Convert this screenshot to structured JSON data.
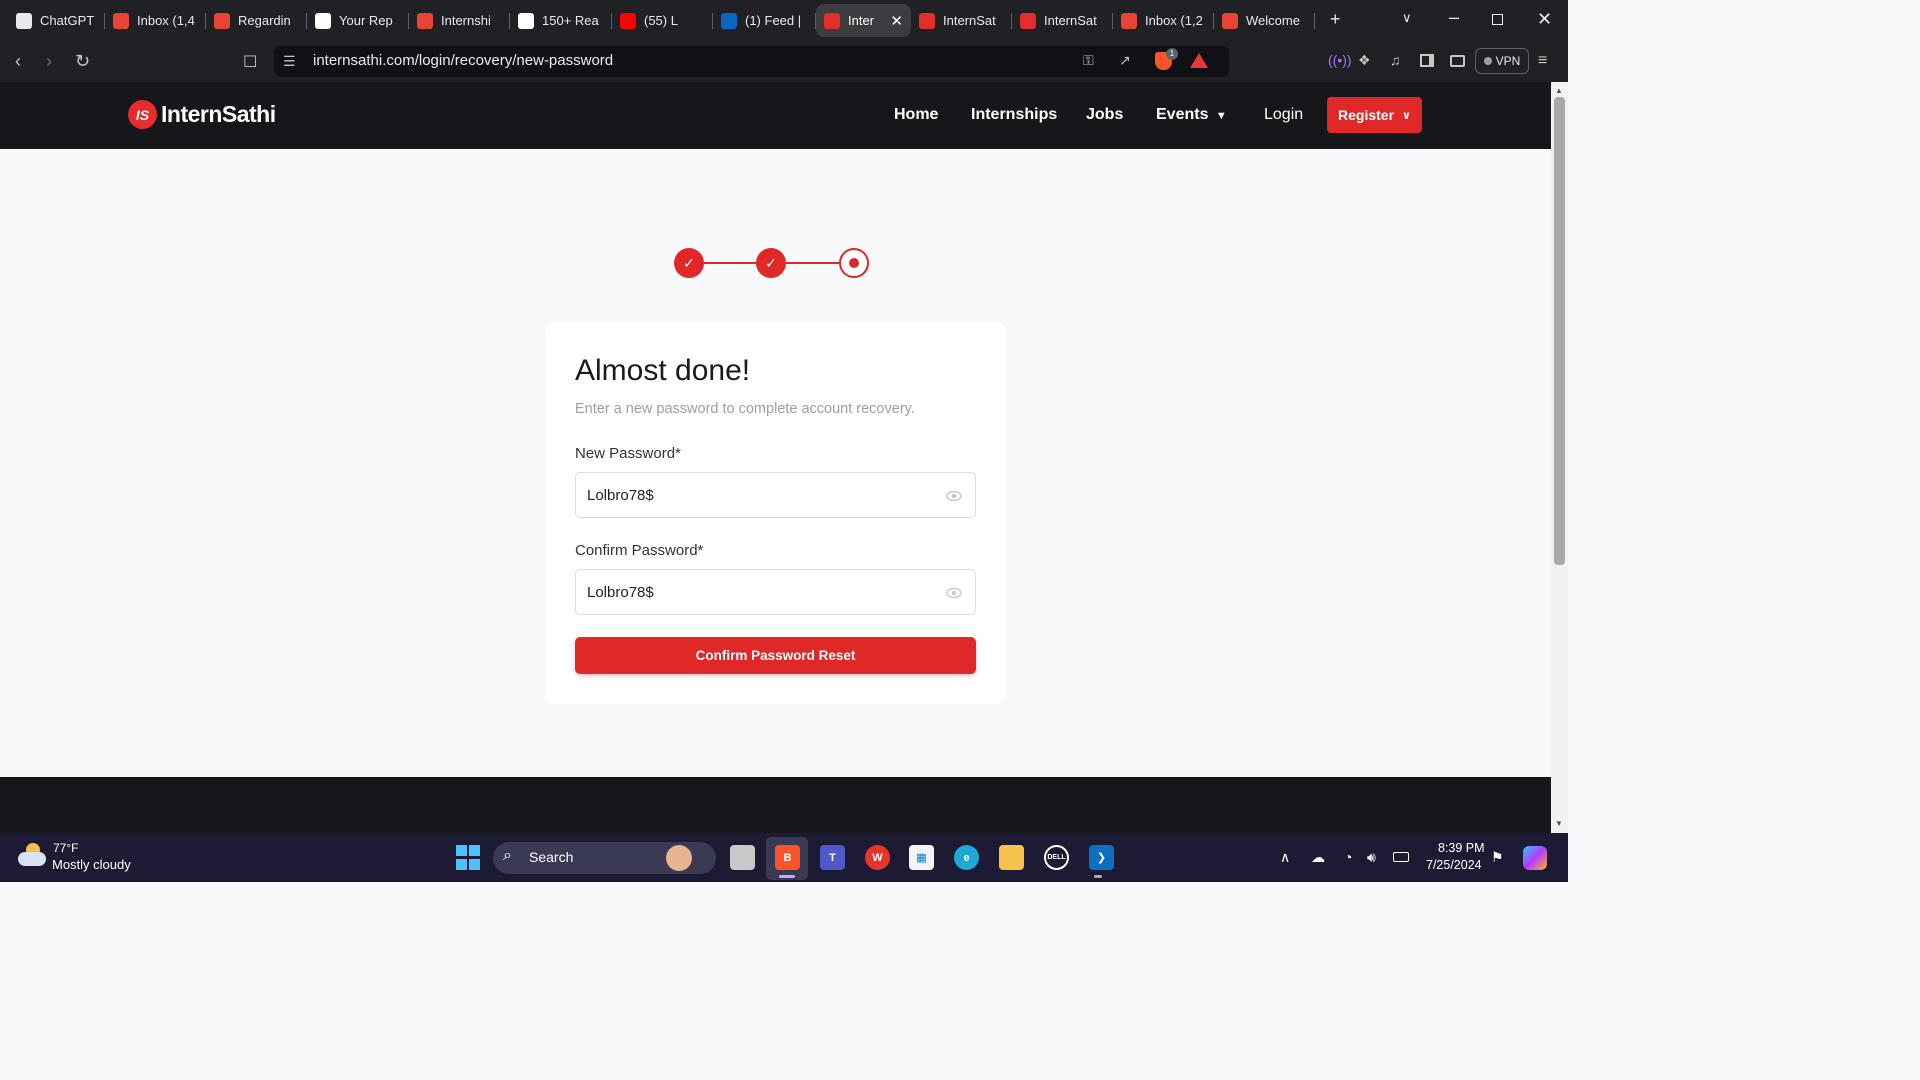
{
  "browser": {
    "tabs": [
      {
        "title": "ChatGPT",
        "icon": "chatgpt-icon",
        "color": "#e8eaed"
      },
      {
        "title": "Inbox (1,4",
        "icon": "gmail-icon",
        "color": "#ea4335"
      },
      {
        "title": "Regardin",
        "icon": "gmail-icon",
        "color": "#ea4335"
      },
      {
        "title": "Your Rep",
        "icon": "github-icon",
        "color": "#ffffff"
      },
      {
        "title": "Internshi",
        "icon": "gmail-icon",
        "color": "#ea4335"
      },
      {
        "title": "150+ Rea",
        "icon": "p-icon",
        "color": "#ffffff"
      },
      {
        "title": "(55) L",
        "icon": "youtube-icon",
        "color": "#ff0000"
      },
      {
        "title": "(1) Feed |",
        "icon": "linkedin-icon",
        "color": "#0a66c2"
      },
      {
        "title": "Inter",
        "icon": "internsathi-icon",
        "color": "#e52d2d",
        "active": true
      },
      {
        "title": "InternSat",
        "icon": "internsathi-icon",
        "color": "#e52d2d"
      },
      {
        "title": "InternSat",
        "icon": "internsathi-icon",
        "color": "#e52d2d"
      },
      {
        "title": "Inbox (1,2",
        "icon": "gmail-icon",
        "color": "#ea4335"
      },
      {
        "title": "Welcome",
        "icon": "gmail-icon",
        "color": "#ea4335"
      }
    ],
    "url": "internsathi.com/login/recovery/new-password",
    "vpn_label": "VPN",
    "shield_count": "1"
  },
  "site": {
    "brand": "InternSathi",
    "logo_mark": "IS",
    "accent": "#e02828",
    "nav": {
      "home": "Home",
      "internships": "Internships",
      "jobs": "Jobs",
      "events": "Events",
      "login": "Login",
      "register": "Register"
    }
  },
  "recovery": {
    "steps": [
      {
        "state": "done"
      },
      {
        "state": "done"
      },
      {
        "state": "current"
      }
    ],
    "title": "Almost done!",
    "subtitle": "Enter a new password to complete account recovery.",
    "new_password_label": "New Password*",
    "new_password_value": "Lolbro78$",
    "confirm_password_label": "Confirm Password*",
    "confirm_password_value": "Lolbro78$",
    "submit_label": "Confirm Password Reset"
  },
  "taskbar": {
    "temperature": "77°F",
    "weather": "Mostly cloudy",
    "search_label": "Search",
    "time": "8:39 PM",
    "date": "7/25/2024"
  }
}
